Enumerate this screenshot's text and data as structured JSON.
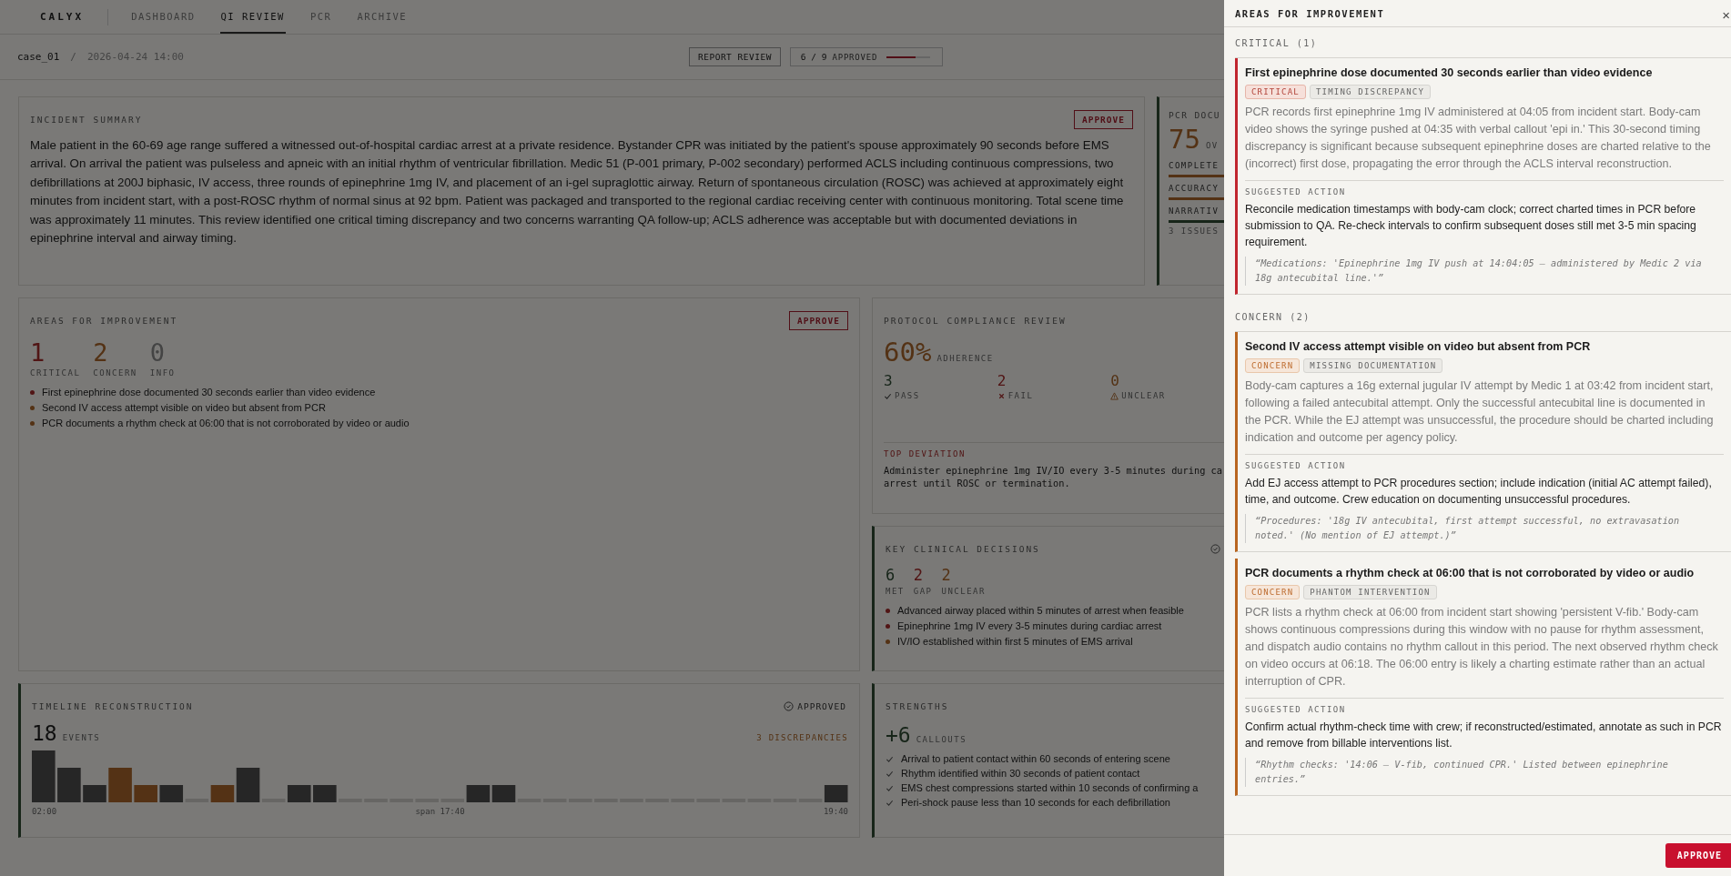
{
  "nav": {
    "brand": "CALYX",
    "items": [
      {
        "label": "DASHBOARD",
        "selected": false
      },
      {
        "label": "QI REVIEW",
        "selected": true
      },
      {
        "label": "PCR",
        "selected": false
      },
      {
        "label": "ARCHIVE",
        "selected": false
      }
    ]
  },
  "breadcrumb": {
    "case": "case_01",
    "separator": "/",
    "datetime": "2026-04-24 14:00"
  },
  "header_actions": {
    "report_button": "REPORT REVIEW",
    "approval": {
      "count": "6 / 9",
      "label": "APPROVED",
      "level": 0.67
    }
  },
  "incident_summary": {
    "title": "INCIDENT SUMMARY",
    "approve": "APPROVE",
    "text": "Male patient in the 60-69 age range suffered a witnessed out-of-hospital cardiac arrest at a private residence. Bystander CPR was initiated by the patient's spouse approximately 90 seconds before EMS arrival. On arrival the patient was pulseless and apneic with an initial rhythm of ventricular fibrillation. Medic 51 (P-001 primary, P-002 secondary) performed ACLS including continuous compressions, two defibrillations at 200J biphasic, IV access, three rounds of epinephrine 1mg IV, and placement of an i-gel supraglottic airway. Return of spontaneous circulation (ROSC) was achieved at approximately eight minutes from incident start, with a post-ROSC rhythm of normal sinus at 92 bpm. Patient was packaged and transported to the regional cardiac receiving center with continuous monitoring. Total scene time was approximately 11 minutes. This review identified one critical timing discrepancy and two concerns warranting QA follow-up; ACLS adherence was acceptable but with documented deviations in epinephrine interval and airway timing."
  },
  "pcr_documentation": {
    "title": "PCR DOCU",
    "score": "75",
    "score_suffix": "OV",
    "metrics": [
      {
        "label": "COMPLETE",
        "color": "#543215"
      },
      {
        "label": "ACCURACY",
        "color": "#543215"
      },
      {
        "label": "NARRATIV",
        "color": "#172519"
      }
    ],
    "issues": "3 ISSUES"
  },
  "areas_for_improvement": {
    "title": "AREAS FOR IMPROVEMENT",
    "approve": "APPROVE",
    "counts": [
      {
        "value": "1",
        "label": "CRITICAL",
        "kind": "critical"
      },
      {
        "value": "2",
        "label": "CONCERN",
        "kind": "concern"
      },
      {
        "value": "0",
        "label": "INFO",
        "kind": "info"
      }
    ],
    "items": [
      {
        "text": "First epinephrine dose documented 30 seconds earlier than video evidence",
        "kind": "critical"
      },
      {
        "text": "Second IV access attempt visible on video but absent from PCR",
        "kind": "concern"
      },
      {
        "text": "PCR documents a rhythm check at 06:00 that is not corroborated by video or audio",
        "kind": "concern"
      }
    ]
  },
  "protocol_compliance": {
    "title": "PROTOCOL COMPLIANCE REVIEW",
    "adherence": "60%",
    "adherence_label": "ADHERENCE",
    "stats": [
      {
        "value": "3",
        "label": "PASS",
        "kind": "pass"
      },
      {
        "value": "2",
        "label": "FAIL",
        "kind": "fail"
      },
      {
        "value": "0",
        "label": "UNCLEAR",
        "kind": "unclear"
      }
    ],
    "deviation_title": "TOP DEVIATION",
    "deviation_lines": [
      "Administer epinephrine 1mg IV/IO every 3-5 minutes during ca",
      "arrest until ROSC or termination."
    ]
  },
  "key_clinical_decisions": {
    "title": "KEY CLINICAL DECISIONS",
    "counts": [
      {
        "value": "6",
        "label": "MET",
        "kind": "met"
      },
      {
        "value": "2",
        "label": "GAP",
        "kind": "gap"
      },
      {
        "value": "2",
        "label": "UNCLEAR",
        "kind": "unclear"
      }
    ],
    "items": [
      {
        "text": "Advanced airway placed within 5 minutes of arrest when feasible",
        "kind": "gap"
      },
      {
        "text": "Epinephrine 1mg IV every 3-5 minutes during cardiac arrest",
        "kind": "gap"
      },
      {
        "text": "IV/IO established within first 5 minutes of EMS arrival",
        "kind": "unclear"
      }
    ]
  },
  "timeline_reconstruction": {
    "title": "TIMELINE RECONSTRUCTION",
    "status": "APPROVED",
    "count": "18",
    "count_label": "EVENTS",
    "discrepancies": "3 DISCREPANCIES",
    "axis": [
      "02:00",
      "span 17:40",
      "19:40"
    ]
  },
  "strengths": {
    "title": "STRENGTHS",
    "count": "+6",
    "count_label": "CALLOUTS",
    "items": [
      "Arrival to patient contact within 60 seconds of entering scene",
      "Rhythm identified within 30 seconds of patient contact",
      "EMS chest compressions started within 10 seconds of confirming a",
      "Peri-shock pause less than 10 seconds for each defibrillation"
    ]
  },
  "panel": {
    "title": "AREAS FOR IMPROVEMENT",
    "close": "×",
    "groups": [
      {
        "heading": "CRITICAL (1)",
        "kind": "critical",
        "issues": [
          {
            "title": "First epinephrine dose documented 30 seconds earlier than video evidence",
            "tags": [
              {
                "label": "CRITICAL",
                "kind": "critical"
              },
              {
                "label": "TIMING DISCREPANCY",
                "kind": "category"
              }
            ],
            "description": "PCR records first epinephrine 1mg IV administered at 04:05 from incident start. Body-cam video shows the syringe pushed at 04:35 with verbal callout 'epi in.' This 30-second timing discrepancy is significant because subsequent epinephrine doses are charted relative to the (incorrect) first dose, propagating the error through the ACLS interval reconstruction.",
            "action_label": "SUGGESTED ACTION",
            "action": "Reconcile medication timestamps with body-cam clock; correct charted times in PCR before submission to QA. Re-check intervals to confirm subsequent doses still met 3-5 min spacing requirement.",
            "quote": "“Medications: 'Epinephrine 1mg IV push at 14:04:05 — administered by Medic 2 via 18g antecubital line.'”"
          }
        ]
      },
      {
        "heading": "CONCERN (2)",
        "kind": "concern",
        "issues": [
          {
            "title": "Second IV access attempt visible on video but absent from PCR",
            "tags": [
              {
                "label": "CONCERN",
                "kind": "concern"
              },
              {
                "label": "MISSING DOCUMENTATION",
                "kind": "category"
              }
            ],
            "description": "Body-cam captures a 16g external jugular IV attempt by Medic 1 at 03:42 from incident start, following a failed antecubital attempt. Only the successful antecubital line is documented in the PCR. While the EJ attempt was unsuccessful, the procedure should be charted including indication and outcome per agency policy.",
            "action_label": "SUGGESTED ACTION",
            "action": "Add EJ access attempt to PCR procedures section; include indication (initial AC attempt failed), time, and outcome. Crew education on documenting unsuccessful procedures.",
            "quote": "“Procedures: '18g IV antecubital, first attempt successful, no extravasation noted.' (No mention of EJ attempt.)”"
          },
          {
            "title": "PCR documents a rhythm check at 06:00 that is not corroborated by video or audio",
            "tags": [
              {
                "label": "CONCERN",
                "kind": "concern"
              },
              {
                "label": "PHANTOM INTERVENTION",
                "kind": "category"
              }
            ],
            "description": "PCR lists a rhythm check at 06:00 from incident start showing 'persistent V-fib.' Body-cam shows continuous compressions during this window with no pause for rhythm assessment, and dispatch audio contains no rhythm callout in this period. The next observed rhythm check on video occurs at 06:18. The 06:00 entry is likely a charting estimate rather than an actual interruption of CPR.",
            "action_label": "SUGGESTED ACTION",
            "action": "Confirm actual rhythm-check time with crew; if reconstructed/estimated, annotate as such in PCR and remove from billable interventions list.",
            "quote": "“Rhythm checks: '14:06 — V-fib, continued CPR.' Listed between epinephrine entries.”"
          }
        ]
      }
    ],
    "approve": "APPROVE"
  }
}
